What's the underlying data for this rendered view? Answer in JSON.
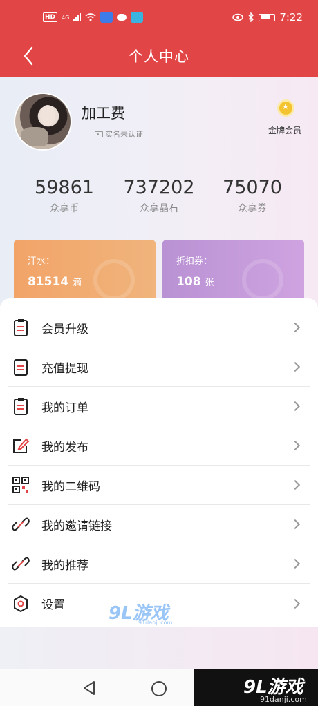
{
  "status_bar": {
    "hd": "HD",
    "network": "4G",
    "time": "7:22"
  },
  "header": {
    "title": "个人中心"
  },
  "profile": {
    "username": "加工费",
    "verify_status": "实名未认证",
    "member_level": "金牌会员"
  },
  "stats": [
    {
      "value": "59861",
      "label": "众享币"
    },
    {
      "value": "737202",
      "label": "众享晶石"
    },
    {
      "value": "75070",
      "label": "众享券"
    }
  ],
  "cards": [
    {
      "label": "汗水：",
      "value": "81514",
      "unit": "滴",
      "color": "#f2a468"
    },
    {
      "label": "折扣券：",
      "value": "108",
      "unit": "张",
      "color": "#b992d4"
    }
  ],
  "menu": [
    {
      "label": "会员升级",
      "icon": "clipboard-icon"
    },
    {
      "label": "充值提现",
      "icon": "clipboard-icon"
    },
    {
      "label": "我的订单",
      "icon": "clipboard-icon"
    },
    {
      "label": "我的发布",
      "icon": "edit-icon"
    },
    {
      "label": "我的二维码",
      "icon": "qr-code-icon"
    },
    {
      "label": "我的邀请链接",
      "icon": "link-icon"
    },
    {
      "label": "我的推荐",
      "icon": "link-icon"
    },
    {
      "label": "设置",
      "icon": "settings-icon"
    }
  ],
  "watermark": {
    "mid_logo": "9L游戏",
    "mid_url": "91danji.com",
    "corner_logo": "9L游戏",
    "corner_url": "91danji.com"
  },
  "colors": {
    "header_red": "#e24546",
    "sweat_card": "#f2a468",
    "coupon_card": "#b992d4",
    "gold": "#f4c430"
  }
}
